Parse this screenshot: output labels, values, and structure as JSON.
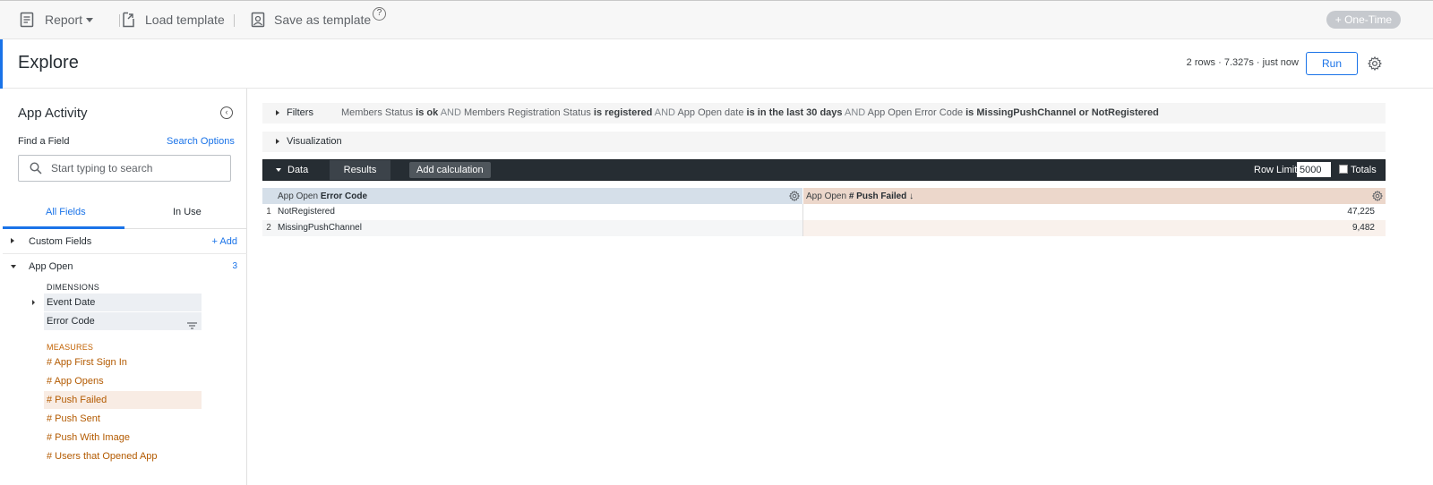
{
  "toolbar": {
    "report_label": "Report",
    "load_template_label": "Load template",
    "save_template_label": "Save as template",
    "help_glyph": "?",
    "one_time_label": "+ One-Time"
  },
  "header": {
    "title": "Explore",
    "run_meta": "2 rows · 7.327s · just now",
    "run_label": "Run"
  },
  "sidebar": {
    "title": "App Activity",
    "collapse_glyph": "‹",
    "find_label": "Find a Field",
    "search_options_label": "Search Options",
    "search_placeholder": "Start typing to search",
    "tabs": [
      {
        "label": "All Fields"
      },
      {
        "label": "In Use"
      }
    ],
    "groups": [
      {
        "label": "Custom Fields",
        "action": "+ Add"
      },
      {
        "label": "App Open",
        "count": "3"
      }
    ],
    "dimensions_heading": "DIMENSIONS",
    "dimensions": [
      {
        "label": "Event Date"
      },
      {
        "label": "Error Code"
      }
    ],
    "measures_heading": "MEASURES",
    "measures": [
      {
        "label": "# App First Sign In"
      },
      {
        "label": "# App Opens"
      },
      {
        "label": "# Push Failed"
      },
      {
        "label": "# Push Sent"
      },
      {
        "label": "# Push With Image"
      },
      {
        "label": "# Users that Opened App"
      }
    ]
  },
  "filters": {
    "title": "Filters",
    "clauses": [
      {
        "field": "Members Status",
        "op": "is ok"
      },
      {
        "field": "Members Registration Status",
        "op": "is registered"
      },
      {
        "field": "App Open date",
        "op": "is in the last 30 days"
      },
      {
        "field": "App Open Error Code",
        "op": "is MissingPushChannel or NotRegistered"
      }
    ],
    "joiner": "AND"
  },
  "visualization": {
    "title": "Visualization"
  },
  "data_bar": {
    "data_label": "Data",
    "results_label": "Results",
    "add_calc_label": "Add calculation",
    "row_limit_label": "Row Limit",
    "row_limit_value": "5000",
    "totals_label": "Totals"
  },
  "table": {
    "columns": [
      {
        "view": "App Open",
        "field": "Error Code"
      },
      {
        "view": "App Open",
        "field": "# Push Failed ↓"
      }
    ],
    "rows": [
      {
        "index": "1",
        "error_code": "NotRegistered",
        "push_failed": "47,225"
      },
      {
        "index": "2",
        "error_code": "MissingPushChannel",
        "push_failed": "9,482"
      }
    ]
  },
  "colors": {
    "accent": "#1a73e8",
    "dimension_header": "#d5dfe9",
    "measure_header": "#ecd7cb",
    "measure_text": "#b35a00",
    "data_bar": "#262d33"
  }
}
